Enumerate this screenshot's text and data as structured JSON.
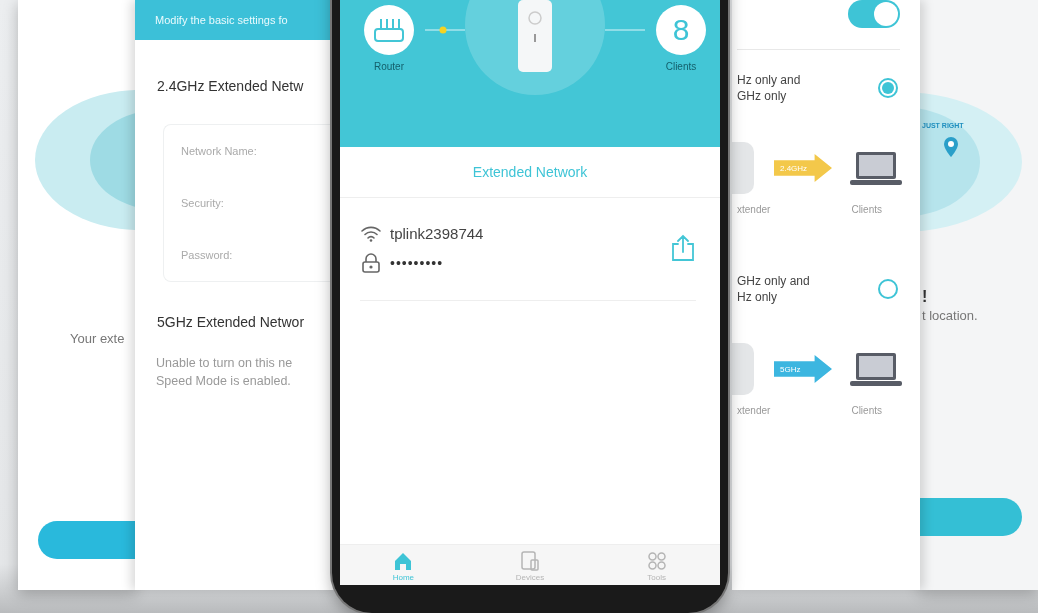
{
  "back_left_screen": {
    "message": "Your exte"
  },
  "back_right_screen": {
    "map_label": "JUST RIGHT",
    "heading": "!",
    "message": "t location."
  },
  "settings_screen": {
    "header": "Modify the basic settings fo",
    "band_24": {
      "title": "2.4GHz Extended Netw",
      "fields": [
        {
          "label": "Network Name:"
        },
        {
          "label": "Security:"
        },
        {
          "label": "Password:"
        }
      ]
    },
    "band_5": {
      "title": "5GHz Extended Networ",
      "note": "Unable to turn on this ne\nSpeed Mode is enabled."
    }
  },
  "band_screen": {
    "toggle": {
      "on": true
    },
    "options": [
      {
        "lines": [
          "Hz only and",
          "GHz only"
        ],
        "selected": true,
        "band": "2.4GHz",
        "color": "#f3c84a",
        "source": "xtender",
        "target": "Clients"
      },
      {
        "lines": [
          "GHz only and",
          "Hz only"
        ],
        "selected": false,
        "band": "5GHz",
        "color": "#3cb6e0",
        "source": "xtender",
        "target": "Clients"
      }
    ]
  },
  "phone": {
    "router_label": "Router",
    "clients_count": "8",
    "clients_label": "Clients",
    "section_title": "Extended Network",
    "network": {
      "ssid": "tplink2398744",
      "password": "•••••••••"
    },
    "nav": [
      {
        "kind": "home",
        "label": "Home",
        "selected": true
      },
      {
        "kind": "devices",
        "label": "Devices",
        "selected": false
      },
      {
        "kind": "tools",
        "label": "Tools",
        "selected": false
      }
    ]
  }
}
